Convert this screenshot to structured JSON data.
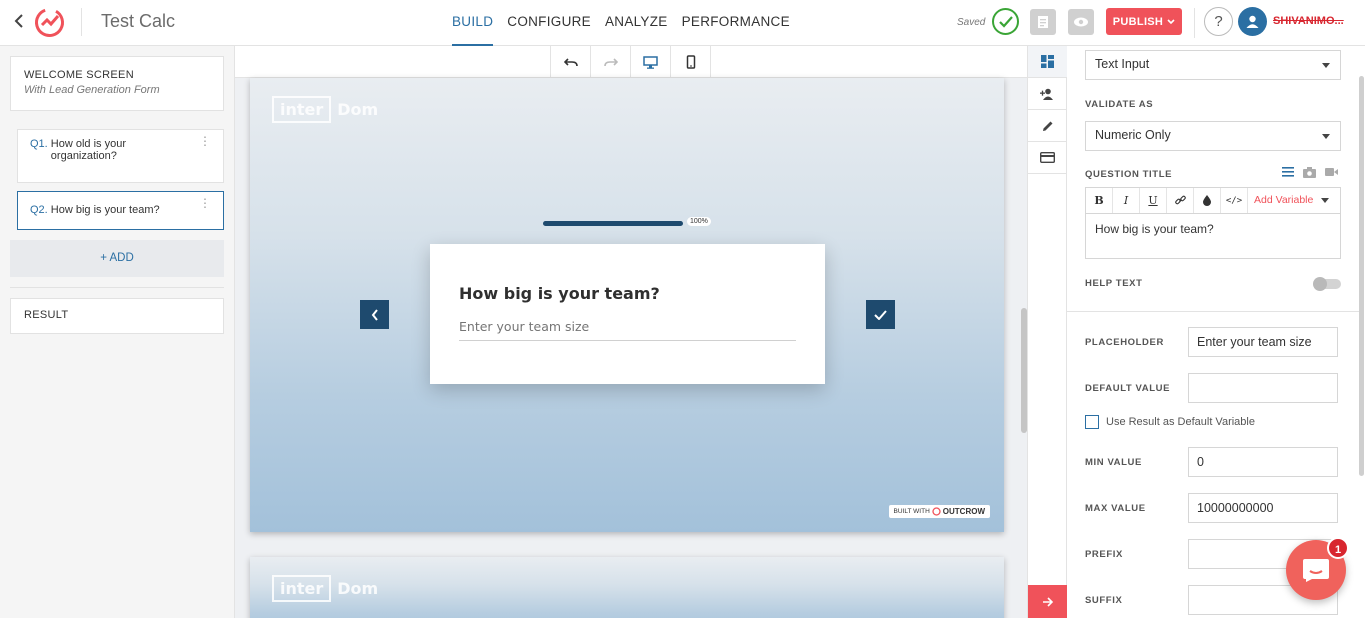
{
  "header": {
    "app_title": "Test Calc",
    "tabs": [
      {
        "label": "BUILD",
        "active": true
      },
      {
        "label": "CONFIGURE",
        "active": false
      },
      {
        "label": "ANALYZE",
        "active": false
      },
      {
        "label": "PERFORMANCE",
        "active": false
      }
    ],
    "saved_label": "Saved",
    "publish_label": "PUBLISH",
    "help_label": "?",
    "username": "SHIVANIMO..."
  },
  "sidebar": {
    "welcome": {
      "title": "WELCOME SCREEN",
      "subtitle": "With Lead Generation Form"
    },
    "questions": [
      {
        "num": "Q1.",
        "text": "How old is your organization?"
      },
      {
        "num": "Q2.",
        "text": "How big is your team?"
      }
    ],
    "add_label": "+ ADD",
    "result_label": "RESULT"
  },
  "canvas": {
    "brand_box": "inter",
    "brand_text": "Dom",
    "progress_label": "100%",
    "progress_value": 1.0,
    "question_title": "How big is your team?",
    "question_placeholder": "Enter your team size",
    "built_with": "BUILT WITH",
    "built_brand": "OUTCROW"
  },
  "panel": {
    "input_type": "Text Input",
    "validate_label": "VALIDATE AS",
    "validate_value": "Numeric Only",
    "question_title_label": "QUESTION TITLE",
    "add_variable": "Add Variable",
    "question_title_value": "How big is your team?",
    "help_text_label": "HELP TEXT",
    "placeholder_label": "PLACEHOLDER",
    "placeholder_value": "Enter your team size",
    "default_value_label": "DEFAULT VALUE",
    "default_value": "",
    "use_result_label": "Use Result as Default Variable",
    "min_label": "MIN VALUE",
    "min_value": "0",
    "max_label": "MAX VALUE",
    "max_value": "10000000000",
    "prefix_label": "PREFIX",
    "prefix_value": "",
    "suffix_label": "SUFFIX",
    "suffix_value": ""
  },
  "chat": {
    "badge": "1"
  },
  "colors": {
    "accent": "#2b6fa3",
    "publish": "#f0525a",
    "saved": "#3aa536",
    "slide_button": "#1e4a6e"
  }
}
